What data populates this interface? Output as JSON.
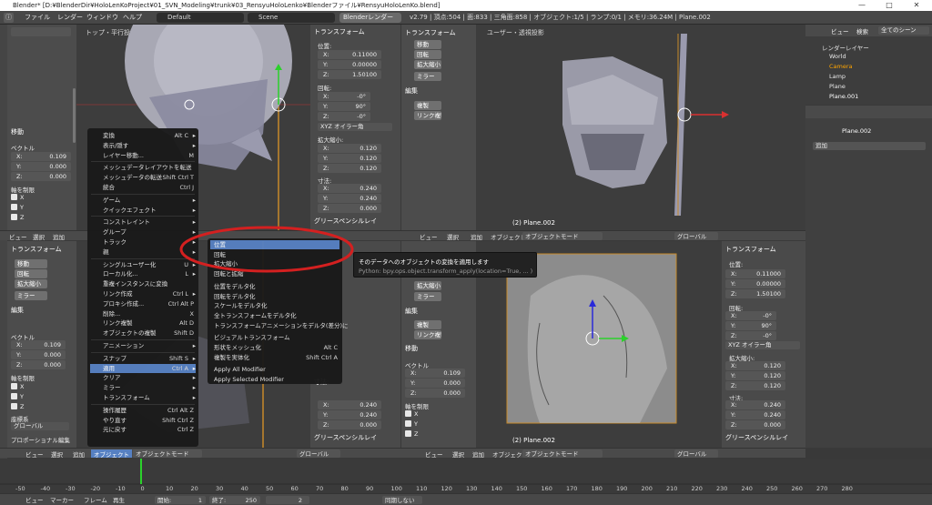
{
  "window": {
    "title": "Blender* [D:¥BlenderDir¥HoloLenKoProject¥01_SVN_Modeling¥trunk¥03_RensyuHoloLenko¥Blenderファイル¥RensyuHoloLenKo.blend]",
    "minimize": "—",
    "maximize": "□",
    "close": "✕"
  },
  "infobar": {
    "menus": [
      "ファイル",
      "レンダー",
      "ウィンドウ",
      "ヘルプ"
    ],
    "layout": "Default",
    "scene": "Scene",
    "engine": "Blenderレンダー",
    "stats": "v2.79 | 頂点:504 | 面:833 | 三角面:858 | オブジェクト:1/5 | ランプ:0/1 | メモリ:36.24M | Plane.002"
  },
  "views": {
    "top_left_label": "トップ・平行投影",
    "top_right_label": "ユーザー・透視投影",
    "object_name": "(2) Plane.002"
  },
  "transform_panel": {
    "header": "トランスフォーム",
    "location_label": "位置:",
    "loc": [
      {
        "axis": "X:",
        "value": "0.11000"
      },
      {
        "axis": "Y:",
        "value": "0.00000"
      },
      {
        "axis": "Z:",
        "value": "1.50100"
      }
    ],
    "rotation_label": "回転:",
    "rot": [
      {
        "axis": "X:",
        "value": "-0°"
      },
      {
        "axis": "Y:",
        "value": "90°"
      },
      {
        "axis": "Z:",
        "value": "-0°"
      }
    ],
    "rotation_mode": "XYZ オイラー角",
    "scale_label": "拡大縮小:",
    "scale": [
      {
        "axis": "X:",
        "value": "0.120"
      },
      {
        "axis": "Y:",
        "value": "0.120"
      },
      {
        "axis": "Z:",
        "value": "0.120"
      }
    ],
    "dimensions_label": "寸法:",
    "dims": [
      {
        "axis": "X:",
        "value": "0.240"
      },
      {
        "axis": "Y:",
        "value": "0.240"
      },
      {
        "axis": "Z:",
        "value": "0.000"
      }
    ],
    "grease_pencil": "グリースペンシルレイ"
  },
  "tool_panel": {
    "transform_header": "トランスフォーム",
    "move": "移動",
    "rotate": "回転",
    "scale": "拡大縮小",
    "mirror": "ミラー",
    "edit_header": "編集",
    "duplicate": "複製",
    "linked_dup": "リンク複製",
    "move_header": "移動",
    "vector_label": "ベクトル",
    "vec": [
      {
        "axis": "X:",
        "value": "0.109"
      },
      {
        "axis": "Y:",
        "value": "0.000"
      },
      {
        "axis": "Z:",
        "value": "0.000"
      }
    ],
    "constraint_label": "軸を制限",
    "constraint_axes": [
      "X",
      "Y",
      "Z"
    ],
    "orientation_label": "座標系",
    "orientation_value": "グローバル",
    "proportional": "プロポーショナル編集"
  },
  "header_bar": {
    "view": "ビュー",
    "select": "選択",
    "add": "追加",
    "object": "オブジェクト",
    "mode": "オブジェクトモード",
    "global": "グローバル"
  },
  "object_menu": {
    "items": [
      {
        "label": "変換",
        "key": "Alt C",
        "arrow": true
      },
      {
        "label": "表示/隠す",
        "key": "",
        "arrow": true
      },
      {
        "label": "レイヤー移動...",
        "key": "M",
        "arrow": false
      },
      {
        "label": "メッシュデータレイアウトを転送",
        "key": "",
        "arrow": false
      },
      {
        "label": "メッシュデータの転送",
        "key": "Shift Ctrl T",
        "arrow": false
      },
      {
        "label": "統合",
        "key": "Ctrl J",
        "arrow": false
      },
      {
        "label": "ゲーム",
        "key": "",
        "arrow": true
      },
      {
        "label": "クイックエフェクト",
        "key": "",
        "arrow": true
      },
      {
        "label": "コンストレイント",
        "key": "",
        "arrow": true
      },
      {
        "label": "グループ",
        "key": "",
        "arrow": true
      },
      {
        "label": "トラック",
        "key": "",
        "arrow": true
      },
      {
        "label": "親",
        "key": "",
        "arrow": true
      },
      {
        "label": "シングルユーザー化",
        "key": "U",
        "arrow": true
      },
      {
        "label": "ローカル化...",
        "key": "L",
        "arrow": true
      },
      {
        "label": "重複インスタンスに変換",
        "key": "",
        "arrow": false
      },
      {
        "label": "リンク作成",
        "key": "Ctrl L",
        "arrow": true
      },
      {
        "label": "プロキシ作成...",
        "key": "Ctrl Alt P",
        "arrow": false
      },
      {
        "label": "削除...",
        "key": "X",
        "arrow": false
      },
      {
        "label": "リンク複製",
        "key": "Alt D",
        "arrow": false
      },
      {
        "label": "オブジェクトの複製",
        "key": "Shift D",
        "arrow": false
      },
      {
        "label": "アニメーション",
        "key": "",
        "arrow": true
      },
      {
        "label": "スナップ",
        "key": "Shift S",
        "arrow": true
      },
      {
        "label": "適用",
        "key": "Ctrl A",
        "arrow": true
      },
      {
        "label": "クリア",
        "key": "",
        "arrow": true
      },
      {
        "label": "ミラー",
        "key": "",
        "arrow": true
      },
      {
        "label": "トランスフォーム",
        "key": "",
        "arrow": true
      },
      {
        "label": "操作履歴",
        "key": "Ctrl Alt Z",
        "arrow": false
      },
      {
        "label": "やり直す",
        "key": "Shift Ctrl Z",
        "arrow": false
      },
      {
        "label": "元に戻す",
        "key": "Ctrl Z",
        "arrow": false
      }
    ]
  },
  "apply_menu": {
    "items": [
      {
        "label": "位置"
      },
      {
        "label": "回転"
      },
      {
        "label": "拡大縮小"
      },
      {
        "label": "回転と拡縮"
      },
      {
        "label": "位置をデルタ化"
      },
      {
        "label": "回転をデルタ化"
      },
      {
        "label": "スケールをデルタ化"
      },
      {
        "label": "全トランスフォームをデルタ化"
      },
      {
        "label": "トランスフォームアニメーションをデルタ(差分)に"
      },
      {
        "label": "ビジュアルトランスフォーム"
      },
      {
        "label": "形状をメッシュ化",
        "key": "Alt C"
      },
      {
        "label": "複製を実体化",
        "key": "Shift Ctrl A"
      },
      {
        "label": "Apply All Modifier"
      },
      {
        "label": "Apply Selected Modifier"
      }
    ]
  },
  "tooltip": {
    "title": "そのデータへのオブジェクトの変換を適用します",
    "python": "Python: bpy.ops.object.transform_apply(location=True, ... )"
  },
  "outliner": {
    "view": "ビュー",
    "search": "検索",
    "scenes": "全てのシーン",
    "rows": [
      "レンダーレイヤー",
      "World",
      "Camera",
      "Lamp",
      "Plane",
      "Plane.001"
    ]
  },
  "properties": {
    "object": "Plane.002",
    "add": "追加"
  },
  "timeline": {
    "ticks": [
      "-50",
      "-40",
      "-30",
      "-20",
      "-10",
      "0",
      "10",
      "20",
      "30",
      "40",
      "50",
      "60",
      "70",
      "80",
      "90",
      "100",
      "110",
      "120",
      "130",
      "140",
      "150",
      "160",
      "170",
      "180",
      "190",
      "200",
      "210",
      "220",
      "230",
      "240",
      "250",
      "260",
      "270",
      "280"
    ],
    "view": "ビュー",
    "marker": "マーカー",
    "frame": "フレーム",
    "playback": "再生",
    "start_label": "開始:",
    "start": "1",
    "end_label": "終了:",
    "end": "250",
    "current": "2",
    "sync": "同期しない"
  }
}
